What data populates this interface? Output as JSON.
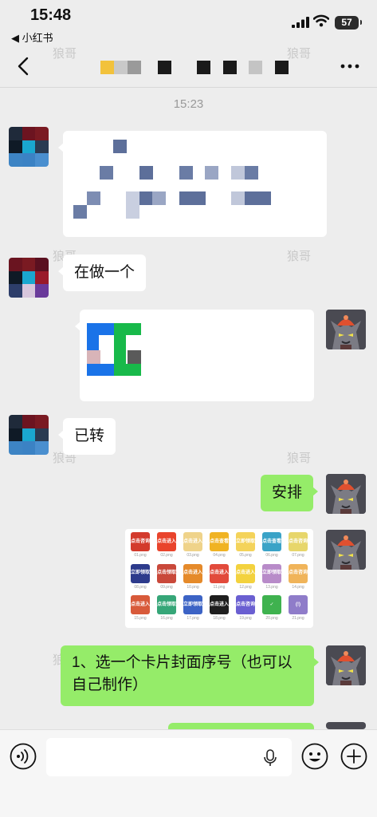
{
  "status_bar": {
    "time": "15:48",
    "back_app": "◀ 小红书",
    "battery": "57"
  },
  "watermark": "狼哥",
  "chat": {
    "timestamp": "15:23",
    "messages": [
      {
        "from": "other",
        "text": "在做一个"
      },
      {
        "from": "other",
        "text": "已转"
      },
      {
        "from": "me",
        "text": "安排"
      },
      {
        "from": "me",
        "text": "1、选一个卡片封面序号（也可以自己制作）"
      }
    ]
  },
  "stickers": [
    {
      "text": "点击咨询",
      "cap": "01.png",
      "bg": "#d33a2c"
    },
    {
      "text": "点击进入",
      "cap": "02.png",
      "bg": "#e9442c"
    },
    {
      "text": "点击进入",
      "cap": "03.png",
      "bg": "#efd38a"
    },
    {
      "text": "点击查看",
      "cap": "04.png",
      "bg": "#f0b323"
    },
    {
      "text": "立即领取",
      "cap": "05.png",
      "bg": "#f4d35a"
    },
    {
      "text": "点击查看",
      "cap": "06.png",
      "bg": "#3aa3c7"
    },
    {
      "text": "点击咨询",
      "cap": "07.png",
      "bg": "#e7d66b"
    },
    {
      "text": "立即领取",
      "cap": "08.png",
      "bg": "#2d3b8c"
    },
    {
      "text": "点击领取",
      "cap": "09.png",
      "bg": "#c9483a"
    },
    {
      "text": "点击进入",
      "cap": "10.png",
      "bg": "#e58a2a"
    },
    {
      "text": "点击进入",
      "cap": "11.png",
      "bg": "#e24a3b"
    },
    {
      "text": "点击进入",
      "cap": "12.png",
      "bg": "#f3d23e"
    },
    {
      "text": "立即领取",
      "cap": "13.png",
      "bg": "#b88bc9"
    },
    {
      "text": "点击咨询",
      "cap": "14.png",
      "bg": "#f0b45a"
    },
    {
      "text": "点击进入",
      "cap": "15.png",
      "bg": "#d85a3a"
    },
    {
      "text": "点击领取",
      "cap": "16.png",
      "bg": "#36a678"
    },
    {
      "text": "立即领取",
      "cap": "17.png",
      "bg": "#3c63c5"
    },
    {
      "text": "点击进入",
      "cap": "18.png",
      "bg": "#1e1e1e"
    },
    {
      "text": "点击咨询",
      "cap": "19.png",
      "bg": "#6a5fd1"
    },
    {
      "text": "✓",
      "cap": "20.png",
      "bg": "#3fb24f"
    },
    {
      "text": "(!)",
      "cap": "21.png",
      "bg": "#8f7cc9"
    }
  ],
  "colors": {
    "bubble_me": "#95ec69",
    "bubble_other": "#ffffff",
    "background": "#ededed"
  },
  "icons": [
    "signal-icon",
    "wifi-icon",
    "back-arrow-icon",
    "more-icon",
    "voice-icon",
    "mic-icon",
    "emoji-icon",
    "plus-icon"
  ]
}
